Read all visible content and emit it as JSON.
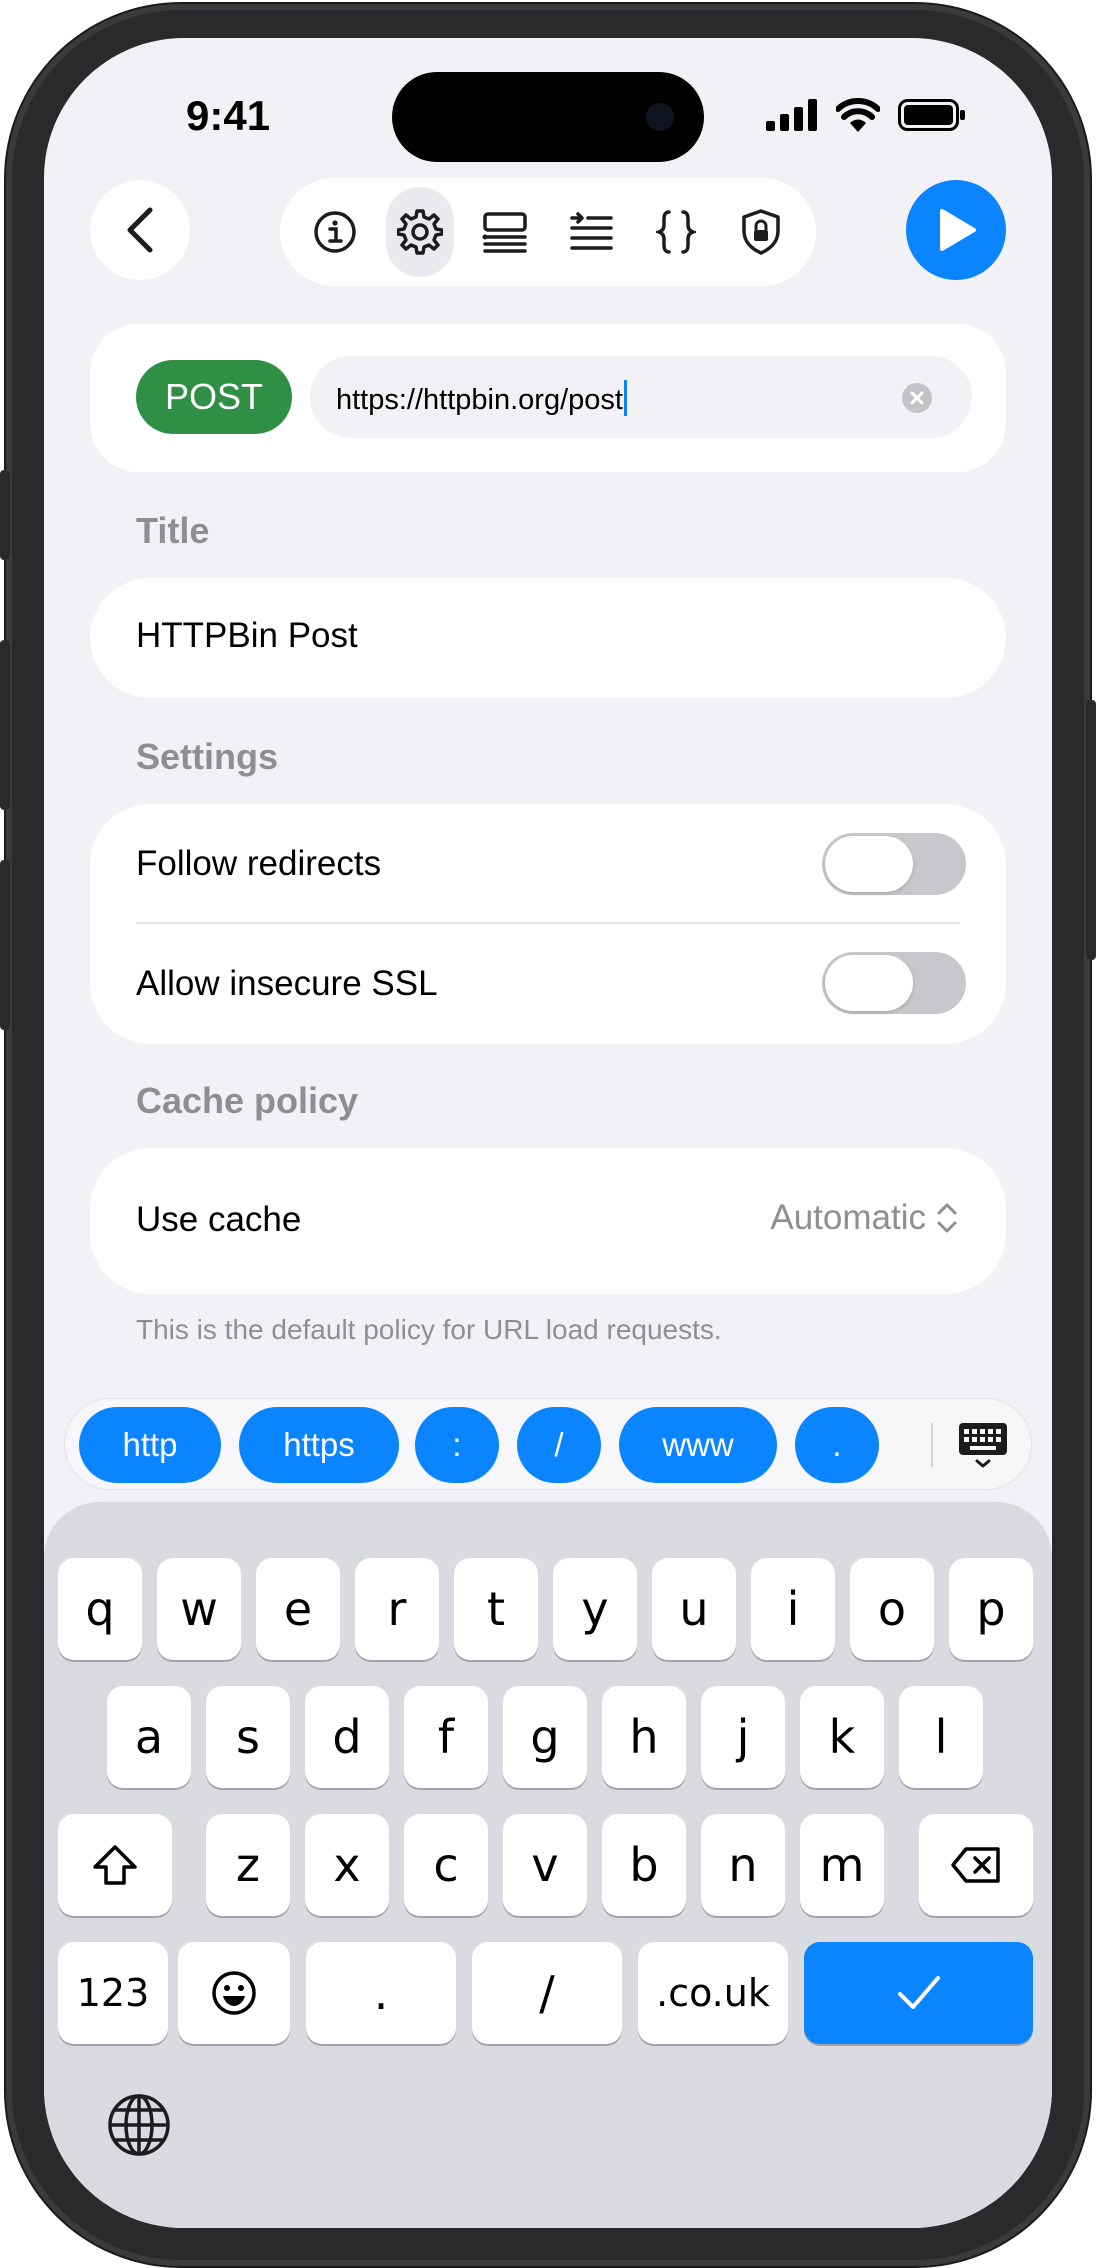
{
  "status": {
    "time": "9:41"
  },
  "toolbar": {
    "tools": [
      "info-icon",
      "gear-icon",
      "table-icon",
      "headers-icon",
      "braces-icon",
      "shield-lock-icon"
    ],
    "active": "gear-icon"
  },
  "request": {
    "method": "POST",
    "url": "https://httpbin.org/post",
    "method_color": "#2f8f44"
  },
  "title_section": {
    "label": "Title",
    "value": "HTTPBin Post"
  },
  "settings_section": {
    "label": "Settings",
    "follow_redirects": {
      "label": "Follow redirects",
      "on": false
    },
    "allow_insecure_ssl": {
      "label": "Allow insecure SSL",
      "on": false
    }
  },
  "cache_section": {
    "label": "Cache policy",
    "row_label": "Use cache",
    "value": "Automatic",
    "footnote": "This is the default policy for URL load requests."
  },
  "suggestions": [
    "http",
    "https",
    ":",
    "/",
    "www",
    "."
  ],
  "keyboard": {
    "row1": [
      "q",
      "w",
      "e",
      "r",
      "t",
      "y",
      "u",
      "i",
      "o",
      "p"
    ],
    "row2": [
      "a",
      "s",
      "d",
      "f",
      "g",
      "h",
      "j",
      "k",
      "l"
    ],
    "row3": [
      "z",
      "x",
      "c",
      "v",
      "b",
      "n",
      "m"
    ],
    "row4": {
      "numbers": "123",
      "dot": ".",
      "slash": "/",
      "domain": ".co.uk"
    }
  },
  "accent_color": "#0a84ff"
}
